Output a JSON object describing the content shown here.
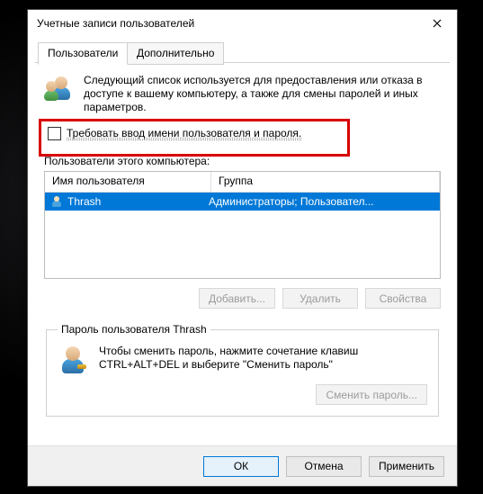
{
  "window": {
    "title": "Учетные записи пользователей"
  },
  "tabs": {
    "users": "Пользователи",
    "advanced": "Дополнительно"
  },
  "intro": "Следующий список используется для предоставления или отказа в доступе к вашему компьютеру, а также для смены паролей и иных параметров.",
  "require_login": {
    "checked": false,
    "label": "Требовать ввод имени пользователя и пароля."
  },
  "list_caption": "Пользователи этого компьютера:",
  "columns": {
    "name": "Имя пользователя",
    "group": "Группа"
  },
  "users": [
    {
      "name": "Thrash",
      "group": "Администраторы; Пользовател...",
      "selected": true
    }
  ],
  "buttons": {
    "add": "Добавить...",
    "remove": "Удалить",
    "properties": "Свойства"
  },
  "password_box": {
    "legend": "Пароль пользователя Thrash",
    "text": "Чтобы сменить пароль, нажмите сочетание клавиш CTRL+ALT+DEL и выберите \"Сменить пароль\"",
    "button": "Сменить пароль..."
  },
  "footer": {
    "ok": "ОК",
    "cancel": "Отмена",
    "apply": "Применить"
  }
}
